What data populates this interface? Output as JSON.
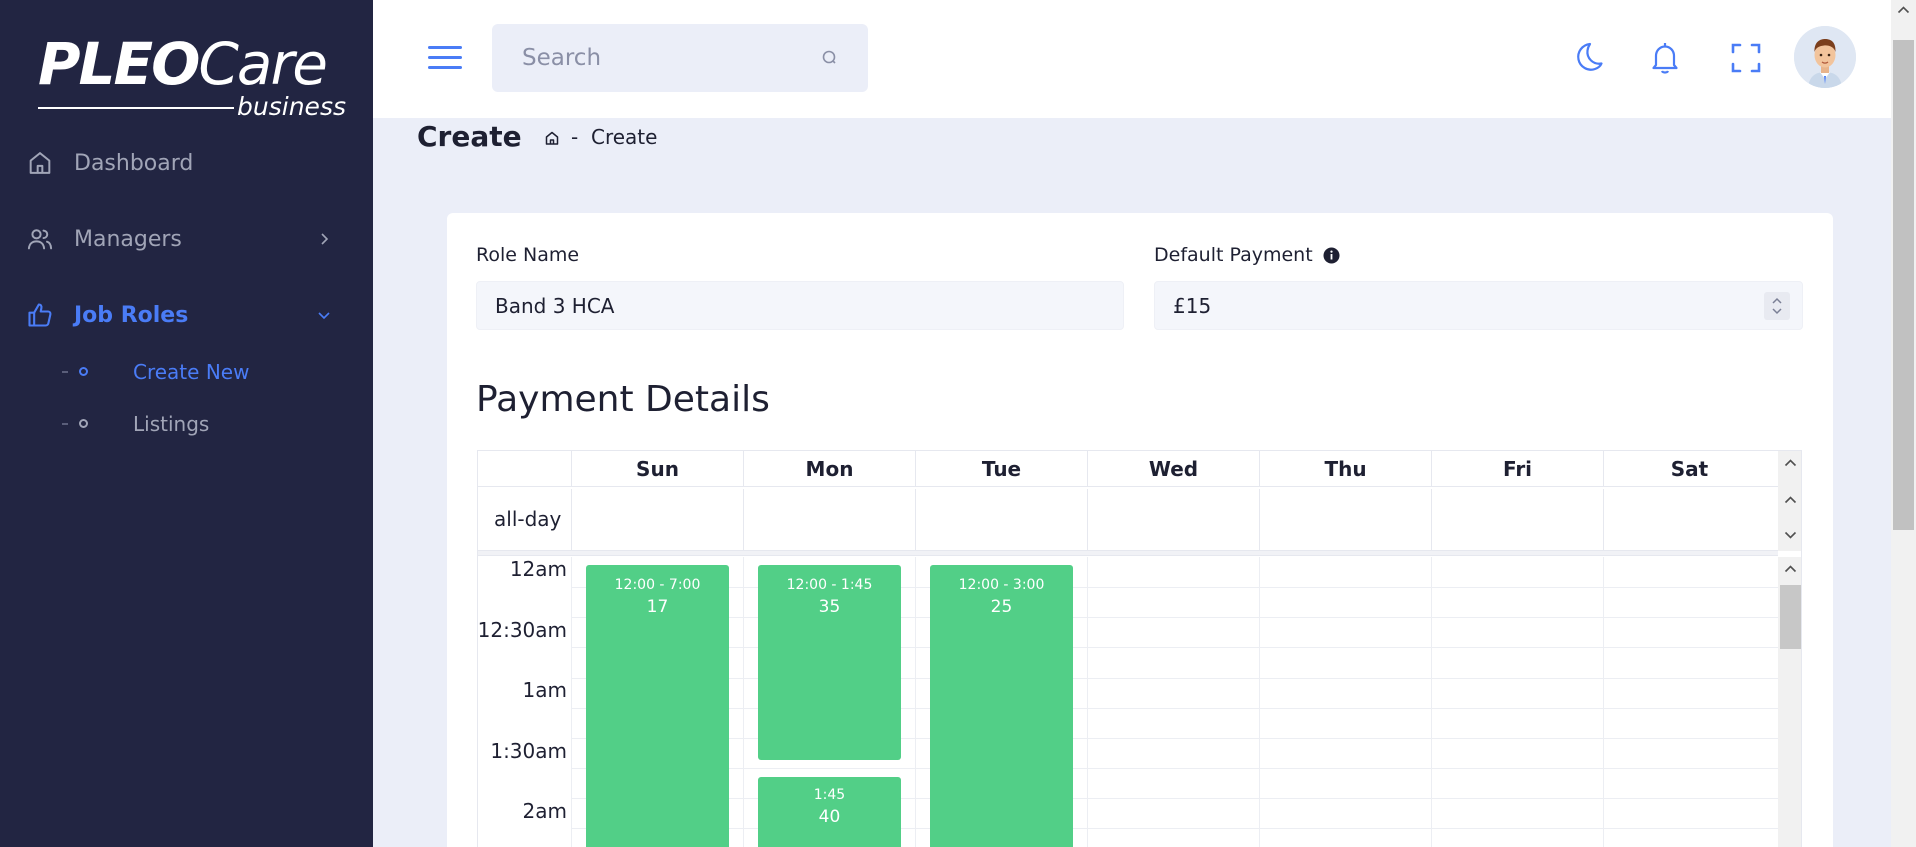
{
  "sidebar": {
    "logo": {
      "main_bold": "PLEO",
      "main_light": "Care",
      "sub": "business"
    },
    "items": [
      {
        "label": "Dashboard",
        "icon": "home-icon"
      },
      {
        "label": "Managers",
        "icon": "users-icon"
      },
      {
        "label": "Job Roles",
        "icon": "thumbs-up-icon"
      }
    ],
    "sub_items": [
      {
        "label": "Create New"
      },
      {
        "label": "Listings"
      }
    ]
  },
  "header": {
    "search_placeholder": "Search",
    "icons": [
      "moon-icon",
      "bell-icon",
      "fullscreen-icon",
      "avatar"
    ]
  },
  "breadcrumb": {
    "title": "Create",
    "separator": "-",
    "current": "Create"
  },
  "form": {
    "role_name_label": "Role Name",
    "role_name_value": "Band 3 HCA",
    "default_payment_label": "Default Payment",
    "default_payment_value": "£15"
  },
  "payment_details": {
    "title": "Payment Details",
    "days": [
      "Sun",
      "Mon",
      "Tue",
      "Wed",
      "Thu",
      "Fri",
      "Sat"
    ],
    "allday_label": "all-day",
    "times": [
      "12am",
      "12:30am",
      "1am",
      "1:30am",
      "2am"
    ],
    "events": [
      {
        "day": "Sun",
        "time": "12:00 - 7:00",
        "value": "17"
      },
      {
        "day": "Mon",
        "time": "12:00 - 1:45",
        "value": "35"
      },
      {
        "day": "Mon",
        "time": "1:45",
        "value": "40"
      },
      {
        "day": "Tue",
        "time": "12:00 - 3:00",
        "value": "25"
      }
    ]
  },
  "colors": {
    "sidebar_bg": "#222542",
    "accent": "#4a7cf6",
    "event": "#52cf87",
    "page_bg": "#ebeef8"
  }
}
